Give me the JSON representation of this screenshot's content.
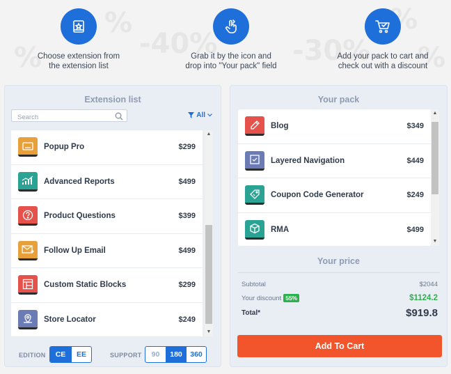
{
  "steps": [
    {
      "icon": "box-icon",
      "text_line1": "Choose extension from",
      "text_line2": "the extension list"
    },
    {
      "icon": "hand-drag-icon",
      "text_line1": "Grab it by the icon and",
      "text_line2": "drop into \"Your pack\" field"
    },
    {
      "icon": "cart-icon",
      "text_line1": "Add your pack to cart and",
      "text_line2": "check out with a discount"
    }
  ],
  "extension_list": {
    "title": "Extension list",
    "search_placeholder": "Search",
    "filter_label": "All",
    "items": [
      {
        "name": "Popup Pro",
        "price": "$299",
        "color": "#e8a13a",
        "icon": "popup-icon"
      },
      {
        "name": "Advanced Reports",
        "price": "$499",
        "color": "#2aa394",
        "icon": "chart-icon"
      },
      {
        "name": "Product Questions",
        "price": "$399",
        "color": "#e5524b",
        "icon": "question-icon"
      },
      {
        "name": "Follow Up Email",
        "price": "$499",
        "color": "#e8a13a",
        "icon": "email-icon"
      },
      {
        "name": "Custom Static Blocks",
        "price": "$299",
        "color": "#e5524b",
        "icon": "blocks-icon"
      },
      {
        "name": "Store Locator",
        "price": "$249",
        "color": "#6a7bb5",
        "icon": "map-pin-icon"
      }
    ],
    "scroll_position": 0.72,
    "edition_label": "EDITION",
    "edition_options": [
      "CE",
      "EE"
    ],
    "edition_selected": "CE",
    "support_label": "SUPPORT",
    "support_options": [
      "90",
      "180",
      "360"
    ],
    "support_selected": "180"
  },
  "your_pack": {
    "title": "Your pack",
    "items": [
      {
        "name": "Blog",
        "price": "$349",
        "color": "#e5524b",
        "icon": "pencil-icon"
      },
      {
        "name": "Layered Navigation",
        "price": "$449",
        "color": "#6a7bb5",
        "icon": "checkbox-icon"
      },
      {
        "name": "Coupon Code Generator",
        "price": "$249",
        "color": "#2aa394",
        "icon": "tag-icon"
      },
      {
        "name": "RMA",
        "price": "$499",
        "color": "#2aa394",
        "icon": "box-return-icon"
      }
    ]
  },
  "your_price": {
    "title": "Your price",
    "subtotal_label": "Subtotal",
    "subtotal_value": "$2044",
    "discount_label": "Your discount",
    "discount_badge": "55%",
    "discount_value": "$1124.2",
    "total_label": "Total*",
    "total_value": "$919.8"
  },
  "add_to_cart_label": "Add To Cart",
  "colors": {
    "primary_blue": "#1e6fd9",
    "cta_orange": "#f2552c",
    "discount_green": "#2bb24c"
  }
}
